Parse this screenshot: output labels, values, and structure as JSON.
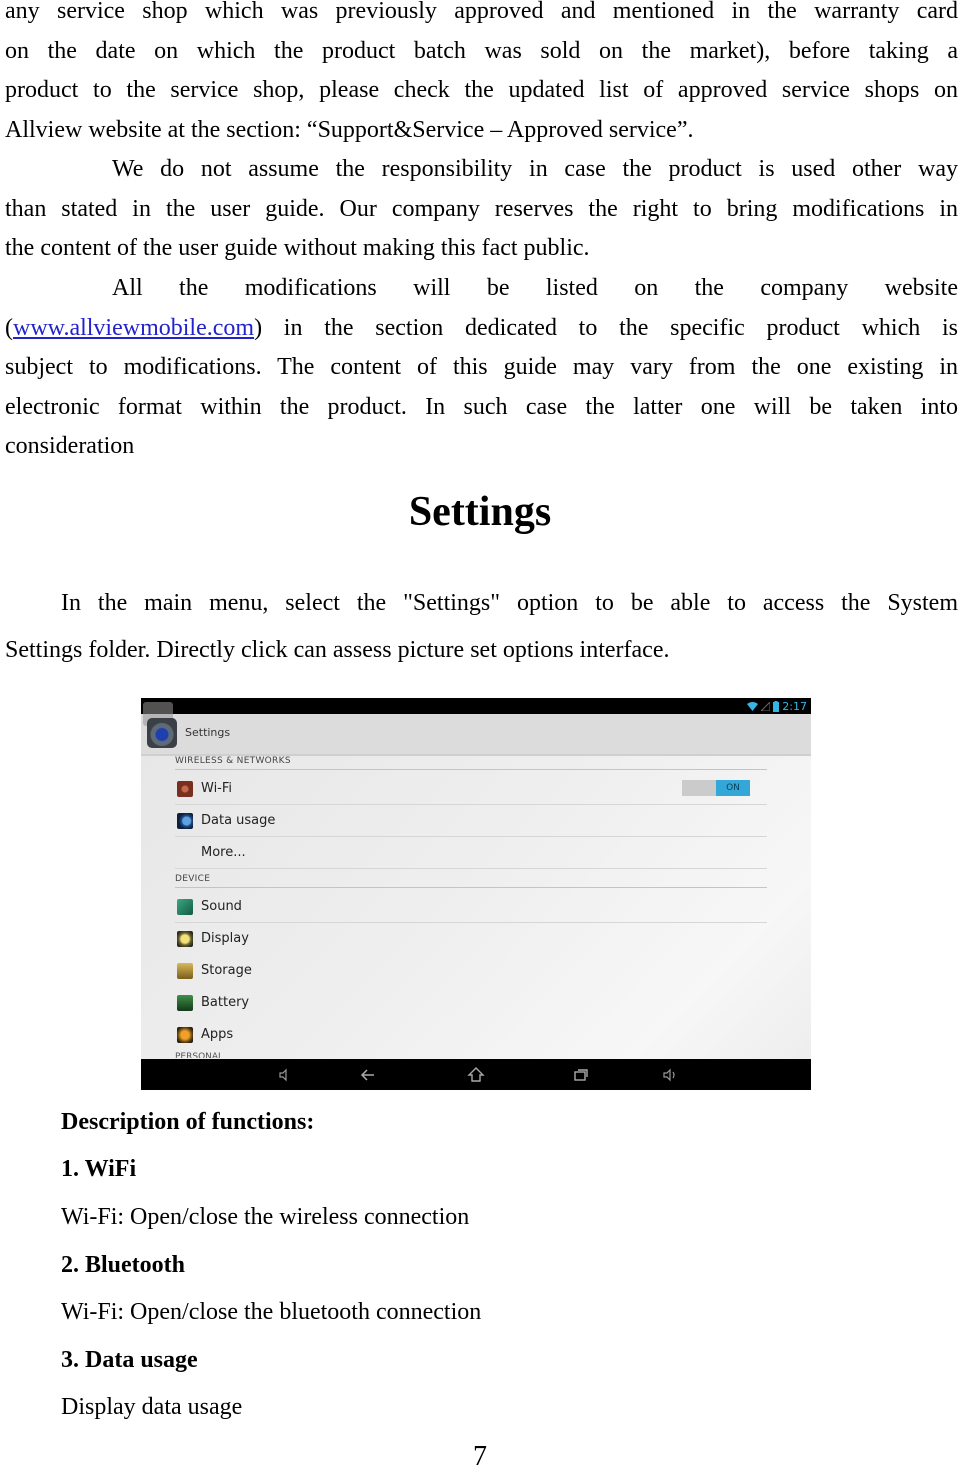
{
  "paragraph1": {
    "lines": [
      "any service shop which was previously approved and mentioned in the warranty card",
      "on the date on which the product batch was sold on the market), before taking a",
      "product to the service shop, please check the updated list of approved service shops on",
      "Allview website at the section: “Support&Service – Approved service”."
    ]
  },
  "paragraph2": {
    "lines": [
      "We do not assume the responsibility in case the product is used other way",
      "than stated in the user guide. Our company reserves the right to bring modifications in",
      "the content of the user guide without making this fact public."
    ]
  },
  "paragraph3": {
    "line1": "All the modifications will be listed on the company website",
    "line2_open": "(",
    "link_text": "www.allviewmobile.com",
    "line2_rest": ") in the section dedicated to the specific product which is",
    "line3": "subject to modifications. The content of this guide may vary from the one existing in",
    "line4": "electronic format within the product. In such case the latter one will be taken into",
    "line5": "consideration"
  },
  "section_title": "Settings",
  "intro": {
    "line1": "In the main menu, select the \"Settings\" option to be able to access the System",
    "line2": "Settings folder. Directly click can assess picture set options interface."
  },
  "screenshot": {
    "status_time": "2:17",
    "action_bar_title": "Settings",
    "sections": [
      {
        "header": "WIRELESS & NETWORKS",
        "items": [
          {
            "label": "Wi-Fi",
            "icon": "wifi-icon",
            "color": "#8a3a26",
            "toggle": "ON"
          },
          {
            "label": "Data usage",
            "icon": "data-usage-icon",
            "color": "#1e4f8f"
          },
          {
            "label": "More...",
            "icon": null
          }
        ]
      },
      {
        "header": "DEVICE",
        "items": [
          {
            "label": "Sound",
            "icon": "sound-icon",
            "color": "#1f7a5c"
          },
          {
            "label": "Display",
            "icon": "display-icon",
            "color": "#8a7a2a"
          },
          {
            "label": "Storage",
            "icon": "storage-icon",
            "color": "#a88a2c"
          },
          {
            "label": "Battery",
            "icon": "battery-icon",
            "color": "#2a6a32"
          },
          {
            "label": "Apps",
            "icon": "apps-icon",
            "color": "#b07a16"
          }
        ]
      }
    ],
    "partial_header": "PERSONAL",
    "nav_buttons": [
      "volume-down-icon",
      "back-icon",
      "home-icon",
      "recent-apps-icon",
      "volume-up-icon"
    ]
  },
  "description": {
    "heading": "Description of functions:",
    "items": [
      {
        "title": "1. WiFi",
        "text": "Wi-Fi: Open/close the wireless connection"
      },
      {
        "title": "2. Bluetooth",
        "text": "Wi-Fi: Open/close the bluetooth connection"
      },
      {
        "title": "3. Data usage",
        "text": "Display data usage"
      }
    ]
  },
  "page_number": "7"
}
